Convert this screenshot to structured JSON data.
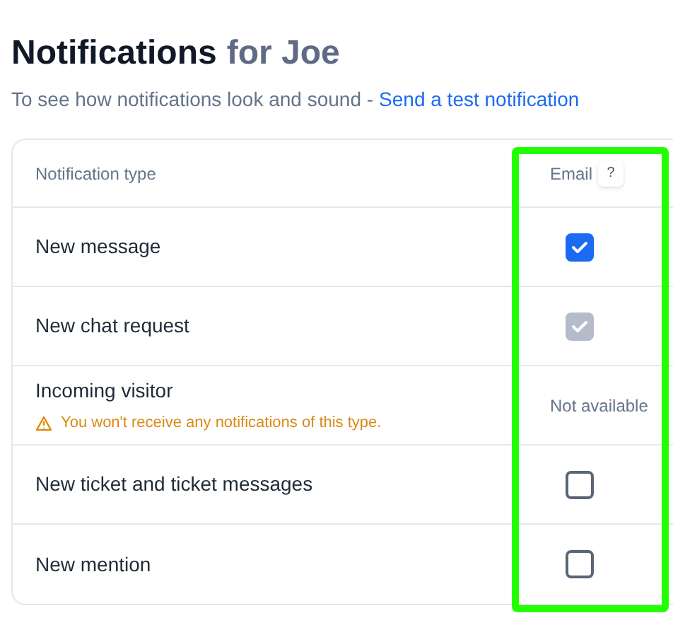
{
  "heading": {
    "title": "Notifications",
    "subject": "for Joe"
  },
  "intro": {
    "text": "To see how notifications look and sound -",
    "link": "Send a test notification"
  },
  "table": {
    "columns": [
      "Notification type",
      "Email"
    ],
    "help": "?",
    "rows": [
      {
        "kind": "checkbox",
        "label": "New message",
        "checked": true,
        "disabled": false
      },
      {
        "kind": "checkbox",
        "label": "New chat request",
        "checked": true,
        "disabled": true
      },
      {
        "kind": "unavailable",
        "label": "Incoming visitor",
        "warning": "You won't receive any notifications of this type.",
        "status": "Not available"
      },
      {
        "kind": "checkbox",
        "label": "New ticket and ticket messages",
        "checked": false,
        "disabled": false
      },
      {
        "kind": "checkbox",
        "label": "New mention",
        "checked": false,
        "disabled": false
      }
    ]
  }
}
